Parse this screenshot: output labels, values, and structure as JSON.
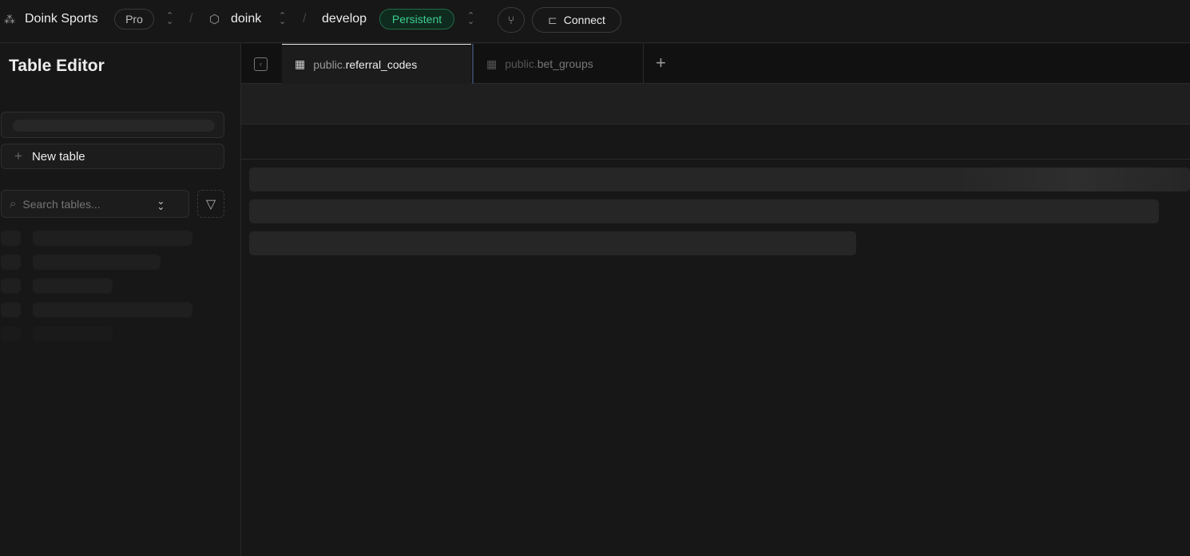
{
  "header": {
    "org": "Doink Sports",
    "plan": "Pro",
    "project": "doink",
    "branch": "develop",
    "branch_badge": "Persistent",
    "connect_label": "Connect"
  },
  "sidebar": {
    "title": "Table Editor",
    "new_table_label": "New table",
    "search_placeholder": "Search tables..."
  },
  "tabs": [
    {
      "schema": "public.",
      "name": "referral_codes",
      "active": true
    },
    {
      "schema": "public.",
      "name": "bet_groups",
      "active": false
    }
  ],
  "colors": {
    "accent": "#3ecf8e",
    "badge_bg": "#0f2a1e"
  }
}
